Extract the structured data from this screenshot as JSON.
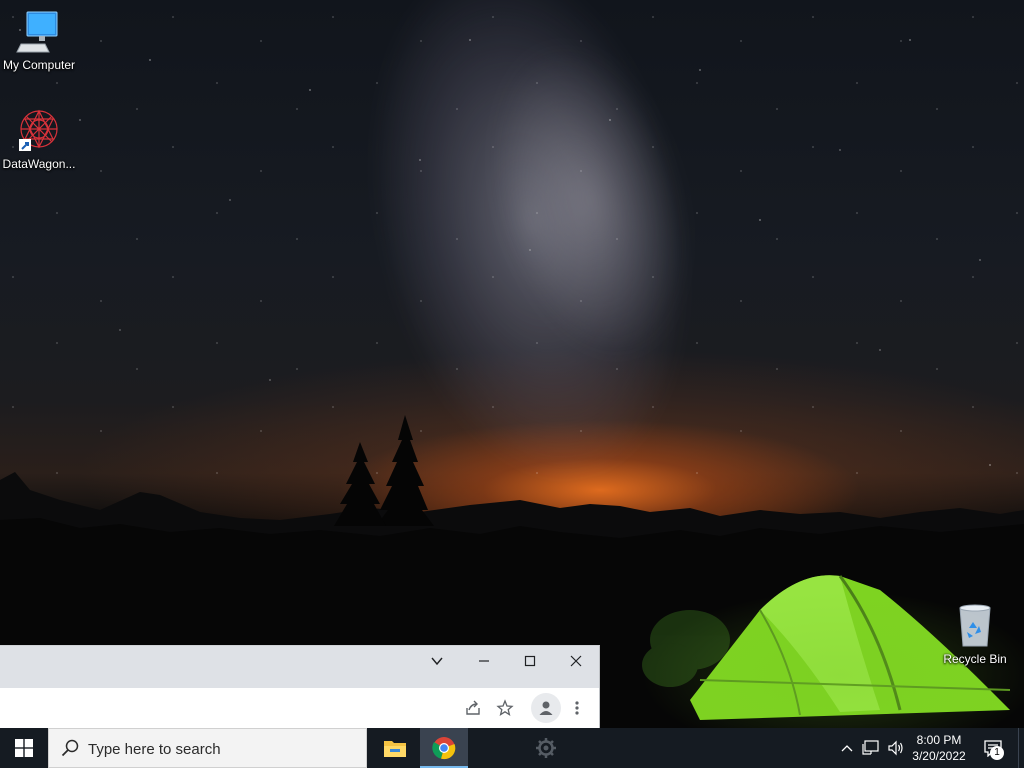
{
  "desktop": {
    "icons": [
      {
        "label": "My Computer",
        "icon": "computer-icon"
      },
      {
        "label": "DataWagon...",
        "icon": "datawagon-icon"
      },
      {
        "label": "Recycle Bin",
        "icon": "recycle-bin-icon"
      }
    ]
  },
  "browser": {
    "titlebar_buttons": [
      "tab-search-icon",
      "minimize-icon",
      "maximize-icon",
      "close-icon"
    ],
    "toolbar_icons": [
      "share-icon",
      "bookmark-star-icon",
      "profile-icon",
      "more-menu-icon"
    ]
  },
  "taskbar": {
    "search_placeholder": "Type here to search",
    "apps": [
      "file-explorer-icon",
      "chrome-icon",
      "settings-icon"
    ],
    "tray_icons": [
      "show-hidden-icons-chevron",
      "network-icon",
      "volume-icon"
    ],
    "clock_time": "8:00 PM",
    "clock_date": "3/20/2022",
    "notification_count": "1"
  },
  "colors": {
    "taskbar_bg": "#151b22",
    "active_indicator": "#76b9ed",
    "browser_frame": "#dee1e6",
    "tent_green": "#7ed321"
  }
}
